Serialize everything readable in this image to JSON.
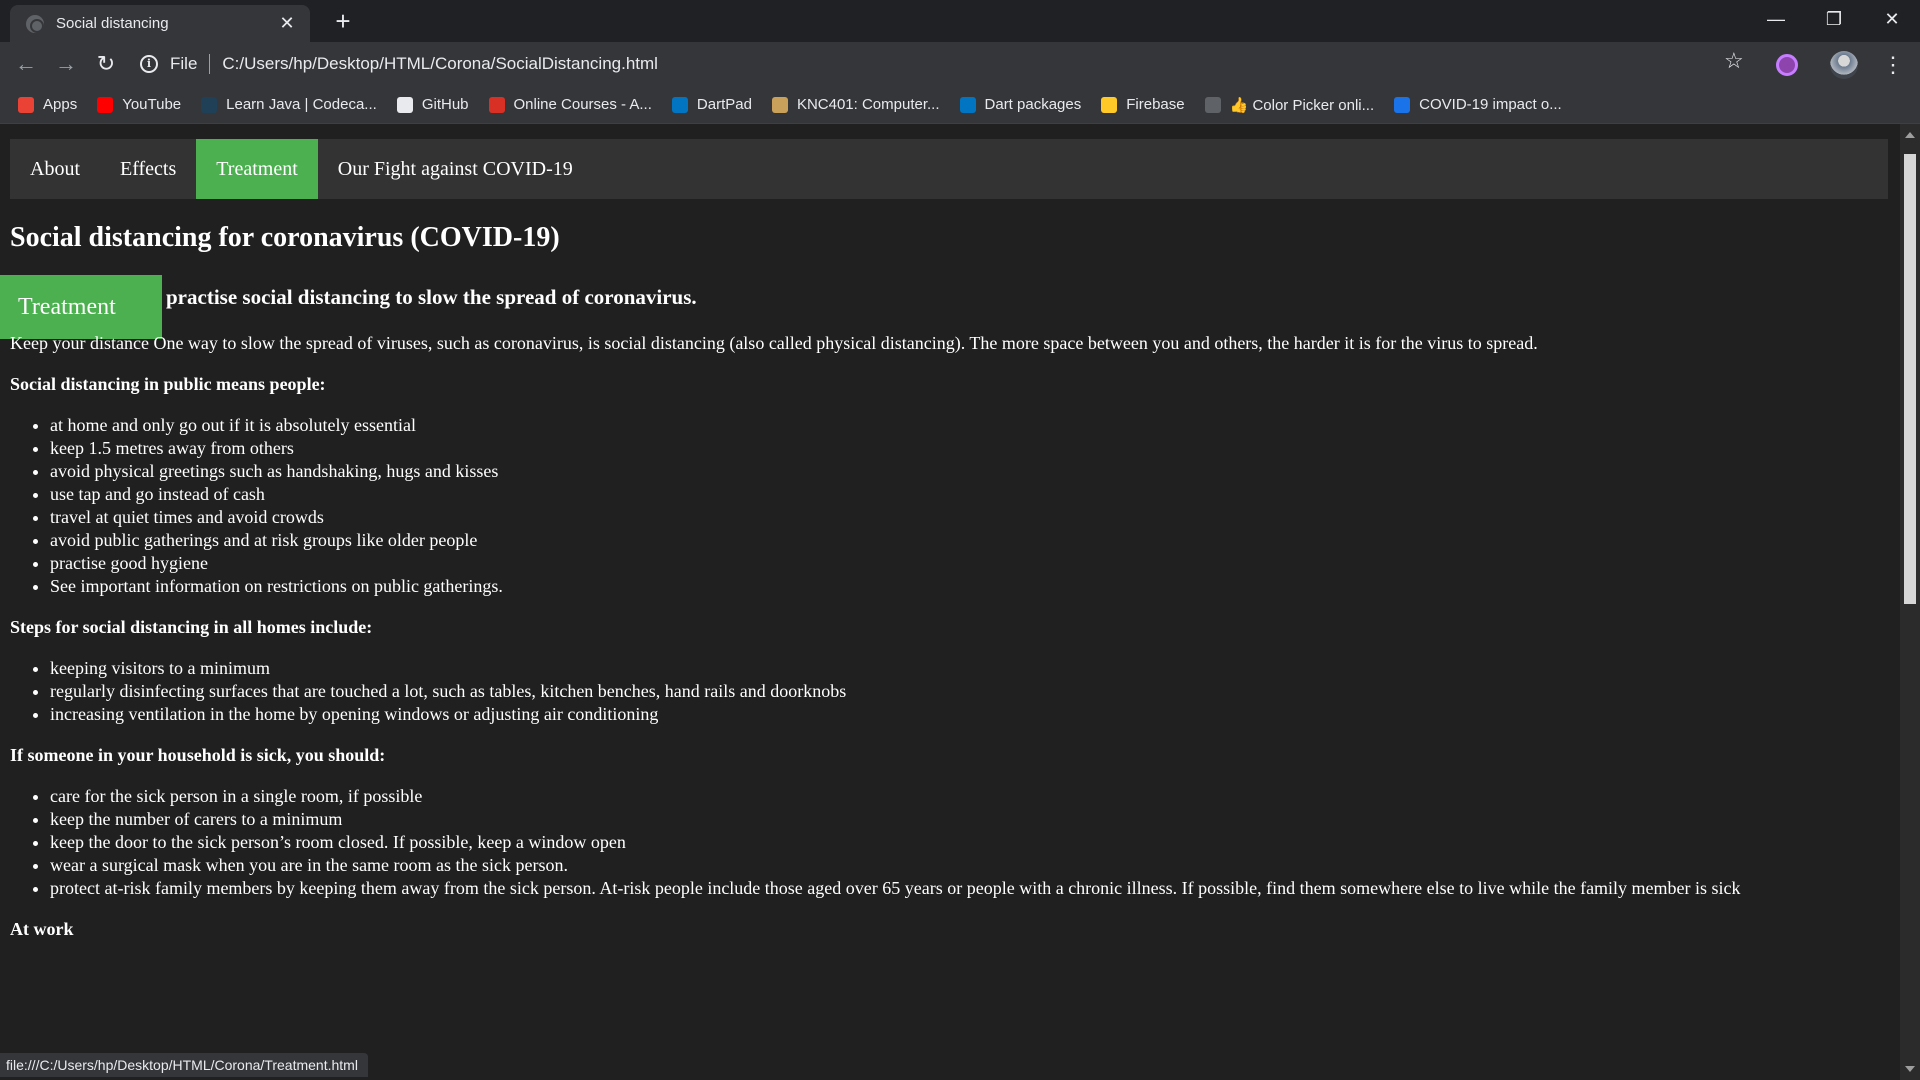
{
  "browser": {
    "tab_title": "Social distancing",
    "tab_close": "✕",
    "new_tab": "+",
    "scheme": "File",
    "url": "C:/Users/hp/Desktop/HTML/Corona/SocialDistancing.html",
    "status_url": "file:///C:/Users/hp/Desktop/HTML/Corona/Treatment.html",
    "bookmarks": [
      {
        "label": "Apps",
        "icon": "apps-grid-icon",
        "color": "#ea4335"
      },
      {
        "label": "YouTube",
        "icon": "youtube-icon",
        "color": "#ff0000"
      },
      {
        "label": "Learn Java | Codeca...",
        "icon": "codecademy-icon",
        "color": "#1f4056"
      },
      {
        "label": "GitHub",
        "icon": "github-icon",
        "color": "#e8eaed"
      },
      {
        "label": "Online Courses - A...",
        "icon": "nptel-icon",
        "color": "#d93025"
      },
      {
        "label": "DartPad",
        "icon": "dart-icon",
        "color": "#0175c2"
      },
      {
        "label": "KNC401: Computer...",
        "icon": "knc-icon",
        "color": "#c9a15b"
      },
      {
        "label": "Dart packages",
        "icon": "dart-icon",
        "color": "#0175c2"
      },
      {
        "label": "Firebase",
        "icon": "firebase-icon",
        "color": "#ffca28"
      },
      {
        "label": "👍 Color Picker onli...",
        "icon": "color-picker-icon",
        "color": "#5f6368"
      },
      {
        "label": "COVID-19 impact o...",
        "icon": "dh-icon",
        "color": "#1a73e8"
      }
    ]
  },
  "page": {
    "nav": [
      "About",
      "Effects",
      "Treatment",
      "Our Fight against COVID-19"
    ],
    "active_nav": "Treatment",
    "title": "Social distancing for coronavirus (COVID-19)",
    "float_tab": "Treatment",
    "subhead": "practise social distancing to slow the spread of coronavirus.",
    "intro": "Keep your distance One way to slow the spread of viruses, such as coronavirus, is social distancing (also called physical distancing). The more space between you and others, the harder it is for the virus to spread.",
    "sections": [
      {
        "title": "Social distancing in public means people:",
        "items": [
          "at home and only go out if it is absolutely essential",
          "keep 1.5 metres away from others",
          "avoid physical greetings such as handshaking, hugs and kisses",
          "use tap and go instead of cash",
          "travel at quiet times and avoid crowds",
          "avoid public gatherings and at risk groups like older people",
          "practise good hygiene",
          "See important information on restrictions on public gatherings."
        ]
      },
      {
        "title": "Steps for social distancing in all homes include:",
        "items": [
          "keeping visitors to a minimum",
          "regularly disinfecting surfaces that are touched a lot, such as tables, kitchen benches, hand rails and doorknobs",
          "increasing ventilation in the home by opening windows or adjusting air conditioning"
        ]
      },
      {
        "title": "If someone in your household is sick, you should:",
        "items": [
          "care for the sick person in a single room, if possible",
          "keep the number of carers to a minimum",
          "keep the door to the sick person’s room closed. If possible, keep a window open",
          "wear a surgical mask when you are in the same room as the sick person.",
          "protect at-risk family members by keeping them away from the sick person. At-risk people include those aged over 65 years or people with a chronic illness. If possible, find them somewhere else to live while the family member is sick"
        ]
      },
      {
        "title": "At work",
        "items": []
      }
    ]
  }
}
